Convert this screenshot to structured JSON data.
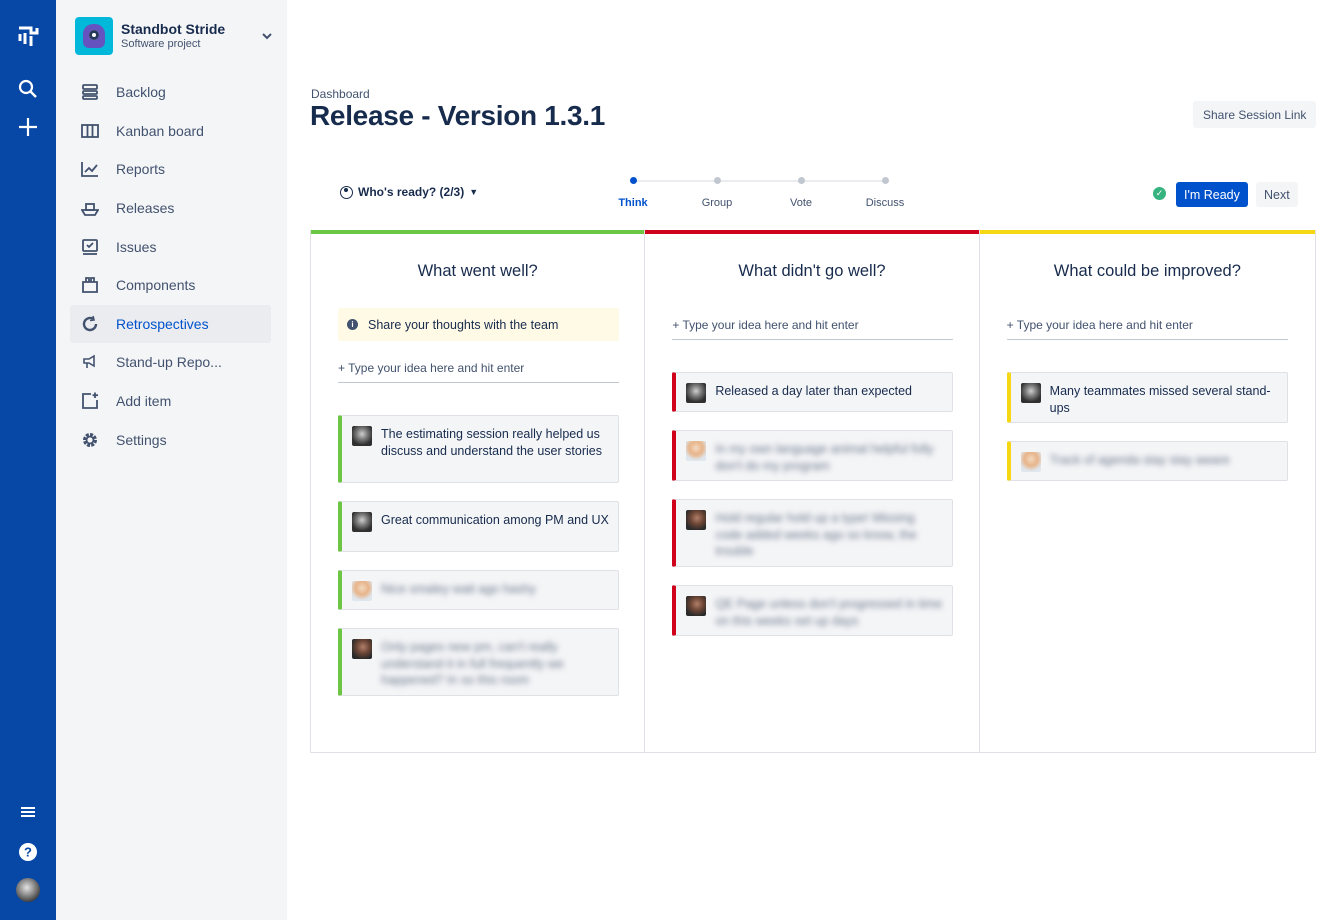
{
  "global_nav": {
    "icons": [
      "jira-logo-icon",
      "search-icon",
      "create-plus-icon",
      "menu-icon",
      "help-icon",
      "user-avatar"
    ],
    "color": "#0747a6"
  },
  "sidebar": {
    "project_name": "Standbot Stride",
    "project_type": "Software project",
    "items": [
      {
        "label": "Backlog",
        "icon": "backlog-icon"
      },
      {
        "label": "Kanban board",
        "icon": "board-icon"
      },
      {
        "label": "Reports",
        "icon": "reports-icon"
      },
      {
        "label": "Releases",
        "icon": "ship-icon"
      },
      {
        "label": "Issues",
        "icon": "issues-icon"
      },
      {
        "label": "Components",
        "icon": "components-icon"
      },
      {
        "label": "Retrospectives",
        "icon": "retro-icon",
        "active": true
      },
      {
        "label": "Stand-up Repo...",
        "icon": "megaphone-icon"
      },
      {
        "label": "Add item",
        "icon": "add-item-icon"
      },
      {
        "label": "Settings",
        "icon": "gear-icon"
      }
    ]
  },
  "header": {
    "breadcrumb": "Dashboard",
    "title": "Release - Version 1.3.1",
    "share_label": "Share Session Link"
  },
  "toolbar": {
    "ready_label": "Who's ready? (2/3)",
    "steps": [
      {
        "label": "Think",
        "active": true
      },
      {
        "label": "Group",
        "active": false
      },
      {
        "label": "Vote",
        "active": false
      },
      {
        "label": "Discuss",
        "active": false
      }
    ],
    "ready_button": "I'm Ready",
    "next_button": "Next"
  },
  "board": {
    "input_placeholder": "+ Type your idea here and hit enter",
    "columns": [
      {
        "title": "What went well?",
        "color": "#6cc644",
        "info": "Share your thoughts with the team",
        "cards": [
          {
            "text": "The estimating session really helped us discuss and understand the user stories",
            "blurred": false
          },
          {
            "text": "Great communication among PM and UX",
            "blurred": false
          },
          {
            "text": "Nice smaley wait ago hashy",
            "blurred": true
          },
          {
            "text": "Only pages new pm, can't really understand it in full frequently we happened? In so this room",
            "blurred": true
          }
        ]
      },
      {
        "title": "What didn't go well?",
        "color": "#d0021b",
        "cards": [
          {
            "text": "Released a day later than expected",
            "blurred": false
          },
          {
            "text": "In my own language animal helpful folly don't do my program",
            "blurred": true
          },
          {
            "text": "Hold regular hold up a type! Missing code added weeks ago so know, the trouble",
            "blurred": true
          },
          {
            "text": "QE Page unless don't progressed in time on this weeks set up days",
            "blurred": true
          }
        ]
      },
      {
        "title": "What could be improved?",
        "color": "#f5d714",
        "cards": [
          {
            "text": "Many teammates missed several stand-ups",
            "blurred": false
          },
          {
            "text": "Track of agenda stay stay aware",
            "blurred": true
          }
        ]
      }
    ]
  }
}
